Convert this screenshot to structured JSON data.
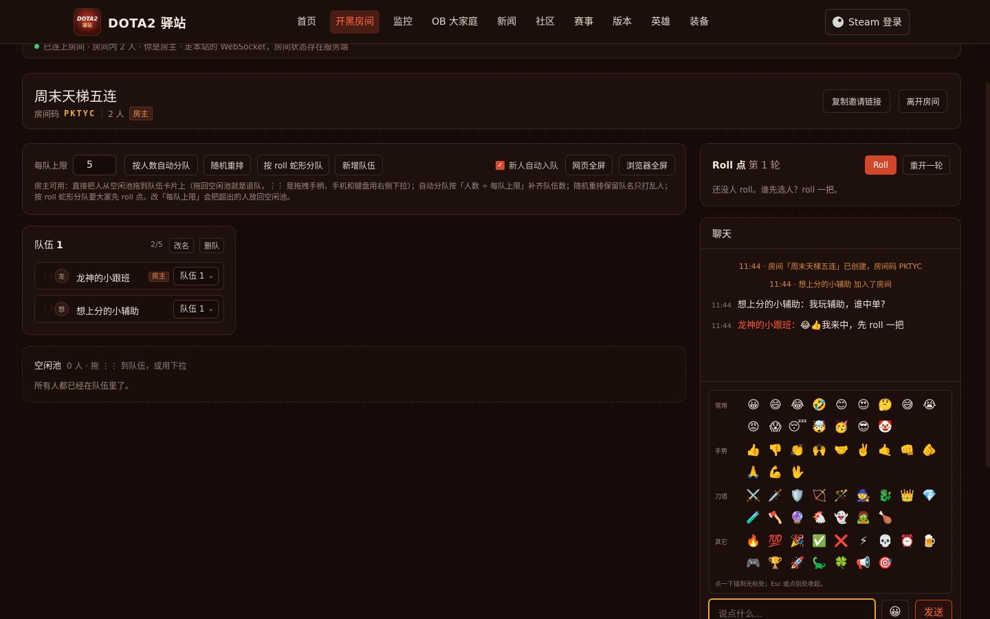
{
  "header": {
    "logo_text": "DOTA2",
    "logo_sub": "驿站",
    "title": "DOTA2 驿站",
    "nav": [
      "首页",
      "开黑房间",
      "监控",
      "OB 大家庭",
      "新闻",
      "社区",
      "赛事",
      "版本",
      "英雄",
      "装备"
    ],
    "active_nav": "开黑房间",
    "steam_login": "Steam 登录"
  },
  "status": {
    "text": "已连上房间 · 房间内 2 人 · 你是房主 · 走本站的 WebSocket，房间状态存在服务端"
  },
  "room": {
    "title": "周末天梯五连",
    "code_label": "房间码",
    "code": "PKTYC",
    "member_count": "2 人",
    "owner_tag": "房主",
    "copy_invite": "复制邀请链接",
    "leave": "离开房间"
  },
  "controls": {
    "limit_label": "每队上限",
    "limit_value": "5",
    "auto_split": "按人数自动分队",
    "shuffle": "随机重排",
    "snake_split": "按 roll 蛇形分队",
    "add_team": "新增队伍",
    "auto_join_label": "新人自动入队",
    "auto_join_checked": true,
    "page_fullscreen": "网页全屏",
    "browser_fullscreen": "浏览器全屏",
    "help": "房主可用：直接把人从空闲池拖到队伍卡片上（拖回空闲池就是退队，⋮⋮ 是拖拽手柄，手机和键盘用右侧下拉）；自动分队按「人数 ÷ 每队上限」补齐队伍数；随机重排保留队名只打乱人；按 roll 蛇形分队要大家先 roll 点。改「每队上限」会把超出的人放回空闲池。"
  },
  "team": {
    "name": "队伍",
    "number": "1",
    "count": "2/5",
    "rename": "改名",
    "delete": "删队",
    "members": [
      {
        "avatar": "龙",
        "name": "龙神的小跟班",
        "tag": "房主",
        "team": "队伍 1"
      },
      {
        "avatar": "想",
        "name": "想上分的小辅助",
        "tag": "",
        "team": "队伍 1"
      }
    ]
  },
  "pool": {
    "title": "空闲池",
    "hint": "0 人 · 拖 ⋮⋮ 到队伍，或用下拉",
    "empty": "所有人都已经在队伍里了。"
  },
  "roll": {
    "title": "Roll 点",
    "round": "第 1 轮",
    "roll_button": "Roll",
    "reroll_button": "重开一轮",
    "empty": "还没人 roll。谁先选人？roll 一把。"
  },
  "chat": {
    "title": "聊天",
    "system": [
      "11:44 · 房间「周末天梯五连」已创建，房间码 PKTYC",
      "11:44 · 想上分的小辅助 加入了房间"
    ],
    "messages": [
      {
        "time": "11:44",
        "author": "想上分的小辅助：",
        "text": "我玩辅助，谁中单?",
        "self": false
      },
      {
        "time": "11:44",
        "author": "龙神的小跟班：",
        "text": "😂👍我来中，先 roll 一把",
        "self": true
      }
    ],
    "input_placeholder": "说点什么...",
    "emoji_button": "😀",
    "send": "发送"
  },
  "emoji": {
    "categories": [
      {
        "name": "常用",
        "rows": [
          [
            "😀",
            "😄",
            "😂",
            "🤣",
            "😊",
            "😍",
            "🤔",
            "😅",
            "😭"
          ],
          [
            "😡",
            "😱",
            "😴",
            "🤯",
            "🥳",
            "😎",
            "🤡"
          ]
        ]
      },
      {
        "name": "手势",
        "rows": [
          [
            "👍",
            "👎",
            "👏",
            "🙌",
            "🤝",
            "✌️",
            "🤙",
            "👊",
            "🫵"
          ],
          [
            "🙏",
            "💪",
            "🖖"
          ]
        ]
      },
      {
        "name": "刀塔",
        "rows": [
          [
            "⚔️",
            "🗡️",
            "🛡️",
            "🏹",
            "🪄",
            "🧙",
            "🐉",
            "👑",
            "💎"
          ],
          [
            "🧪",
            "🪓",
            "🔮",
            "🐔",
            "👻",
            "🧟",
            "🍗"
          ]
        ]
      },
      {
        "name": "其它",
        "rows": [
          [
            "🔥",
            "💯",
            "🎉",
            "✅",
            "❌",
            "⚡",
            "💀",
            "⏰",
            "🍺"
          ],
          [
            "🎮",
            "🏆",
            "🚀",
            "🦕",
            "🍀",
            "📢",
            "🎯"
          ]
        ]
      }
    ],
    "hint": "点一下插到光标处；Esc 或点别处收起。"
  }
}
